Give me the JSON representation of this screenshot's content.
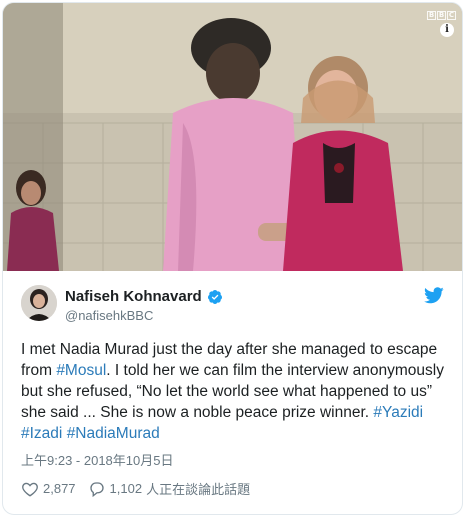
{
  "media": {
    "logo_letters": [
      "B",
      "B",
      "C"
    ],
    "info_glyph": "i"
  },
  "author": {
    "display_name": "Nafiseh Kohnavard",
    "handle": "@nafisehkBBC",
    "verified": true
  },
  "tweet": {
    "segments": [
      {
        "text": "I met Nadia Murad just the day after she managed to escape from ",
        "type": "text"
      },
      {
        "text": "#Mosul",
        "type": "hashtag"
      },
      {
        "text": ". I told her we can film the interview anonymously but she refused, “No let the world see what happened to us” she said ... She is now a noble peace prize winner. ",
        "type": "text"
      },
      {
        "text": "#Yazidi",
        "type": "hashtag"
      },
      {
        "text": " ",
        "type": "text"
      },
      {
        "text": "#Izadi",
        "type": "hashtag"
      },
      {
        "text": " ",
        "type": "text"
      },
      {
        "text": "#NadiaMurad",
        "type": "hashtag"
      }
    ],
    "timestamp": "上午9:23 - 2018年10月5日"
  },
  "actions": {
    "likes": "2,877",
    "replies": "1,102",
    "replies_label": "人正在談論此話題"
  },
  "colors": {
    "link": "#2b7bb9",
    "twitter_blue": "#1da1f2",
    "meta_gray": "#697882"
  },
  "icons": {
    "like": "heart-outline-icon",
    "reply": "speech-bubble-icon",
    "brand": "twitter-bird-icon",
    "verified": "verified-badge-icon"
  }
}
